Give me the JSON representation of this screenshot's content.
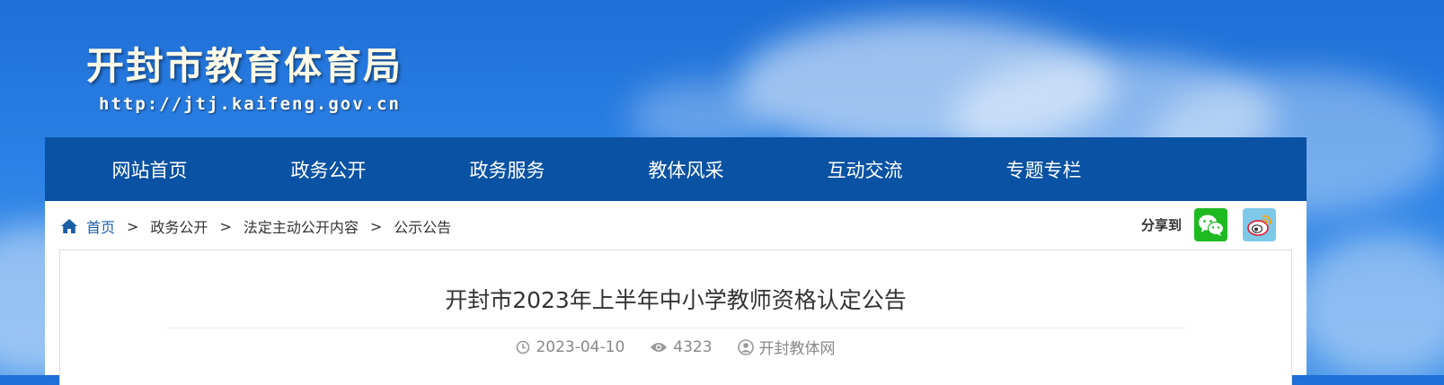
{
  "header": {
    "title": "开封市教育体育局",
    "url": "http://jtj.kaifeng.gov.cn"
  },
  "nav": {
    "items": [
      "网站首页",
      "政务公开",
      "政务服务",
      "教体风采",
      "互动交流",
      "专题专栏"
    ]
  },
  "breadcrumb": {
    "home": "首页",
    "separator": ">",
    "items": [
      "政务公开",
      "法定主动公开内容",
      "公示公告"
    ]
  },
  "share": {
    "label": "分享到",
    "icons": [
      "wechat-icon",
      "weibo-icon"
    ]
  },
  "article": {
    "title": "开封市2023年上半年中小学教师资格认定公告",
    "date": "2023-04-10",
    "views": "4323",
    "source": "开封教体网"
  },
  "colors": {
    "nav_bg": "#0a52a3",
    "link": "#1b5ea8",
    "wechat": "#1fb922",
    "weibo": "#7ec8e8"
  }
}
